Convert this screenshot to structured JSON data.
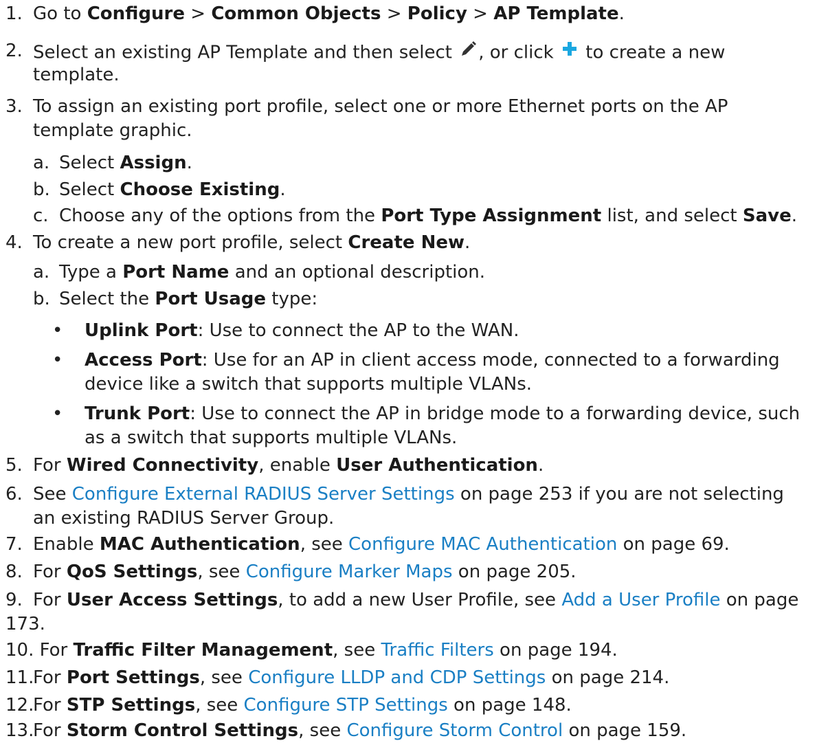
{
  "steps": {
    "s1": {
      "num": "1.",
      "t1": "Go to ",
      "b1": "Configure",
      "t2": " > ",
      "b2": "Common Objects",
      "t3": " > ",
      "b3": "Policy",
      "t4": " > ",
      "b4": "AP Template",
      "t5": "."
    },
    "s2": {
      "num": "2.",
      "t1": "Select an existing AP Template and then select ",
      "t2": ", or click ",
      "t3": " to create a new",
      "cont": "template."
    },
    "s3": {
      "num": "3.",
      "t1": "To assign an existing port profile, select one or more Ethernet ports on the AP",
      "cont": "template graphic."
    },
    "s3a": {
      "num": "a.",
      "t1": "Select ",
      "b1": "Assign",
      "t2": "."
    },
    "s3b": {
      "num": "b.",
      "t1": "Select ",
      "b1": "Choose Existing",
      "t2": "."
    },
    "s3c": {
      "num": "c.",
      "t1": "Choose any of the options from the ",
      "b1": "Port Type Assignment",
      "t2": " list, and select ",
      "b2": "Save",
      "t3": "."
    },
    "s4": {
      "num": "4.",
      "t1": "To create a new port profile, select ",
      "b1": "Create New",
      "t2": "."
    },
    "s4a": {
      "num": "a.",
      "t1": "Type a ",
      "b1": "Port Name",
      "t2": " and an optional description."
    },
    "s4b": {
      "num": "b.",
      "t1": "Select the ",
      "b1": "Port Usage",
      "t2": " type:"
    },
    "bul1": {
      "dot": "•",
      "b1": "Uplink Port",
      "t1": ": Use to connect the AP to the WAN."
    },
    "bul2": {
      "dot": "•",
      "b1": "Access Port",
      "t1": ": Use for an AP in client access mode, connected to a forwarding",
      "cont": "device like a switch that supports multiple VLANs."
    },
    "bul3": {
      "dot": "•",
      "b1": "Trunk Port",
      "t1": ": Use to connect the AP in bridge mode to a forwarding device, such",
      "cont": "as a switch that supports multiple VLANs."
    },
    "s5": {
      "num": "5.",
      "t1": "For ",
      "b1": "Wired Connectivity",
      "t2": ", enable ",
      "b2": "User Authentication",
      "t3": "."
    },
    "s6": {
      "num": "6.",
      "t1": "See ",
      "l1": "Configure External RADIUS Server Settings",
      "t2": " on page 253 if you are not selecting",
      "cont": "an existing RADIUS Server Group."
    },
    "s7": {
      "num": "7.",
      "t1": "Enable ",
      "b1": "MAC Authentication",
      "t2": ", see ",
      "l1": "Configure MAC Authentication",
      "t3": " on page 69."
    },
    "s8": {
      "num": "8.",
      "t1": "For ",
      "b1": "QoS Settings",
      "t2": ", see ",
      "l1": "Configure Marker Maps",
      "t3": " on page 205."
    },
    "s9": {
      "num": "9.",
      "t1": "For ",
      "b1": "User Access Settings",
      "t2": ", to add a new User Profile, see ",
      "l1": "Add a User Profile",
      "t3": " on page",
      "cont": "173."
    },
    "s10": {
      "text": "10. For ",
      "b1": "Traffic Filter Management",
      "t2": ", see ",
      "l1": "Traffic Filters",
      "t3": " on page 194."
    },
    "s11": {
      "num": "11.",
      "t1": "For ",
      "b1": "Port Settings",
      "t2": ", see ",
      "l1": "Configure LLDP and CDP Settings",
      "t3": " on page 214."
    },
    "s12": {
      "num": "12.",
      "t1": "For ",
      "b1": "STP Settings",
      "t2": ", see ",
      "l1": "Configure STP Settings",
      "t3": " on page 148."
    },
    "s13": {
      "num": "13.",
      "t1": "For ",
      "b1": "Storm Control Settings",
      "t2": ", see ",
      "l1": "Configure Storm Control",
      "t3": " on page 159."
    }
  },
  "icons": {
    "edit": "pencil-icon",
    "add": "plus-icon"
  },
  "colors": {
    "text": "#222222",
    "link": "#1a7fc4",
    "add_icon": "#1aa7e0"
  }
}
